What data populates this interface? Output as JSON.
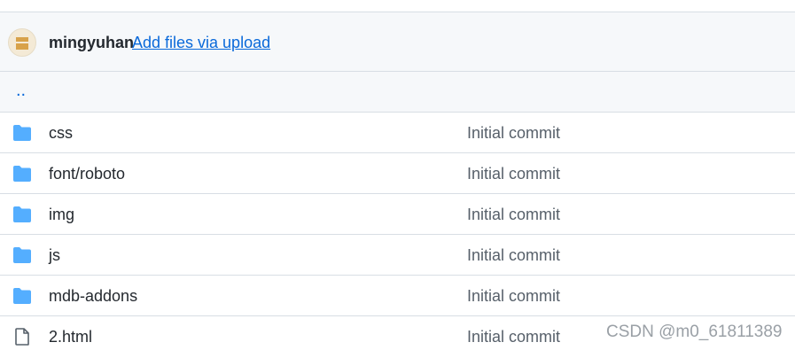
{
  "commit_bar": {
    "author": "mingyuhan",
    "message": "Add files via upload"
  },
  "parent_dir": {
    "label": ".."
  },
  "files": [
    {
      "name": "css",
      "type": "folder",
      "commit_message": "Initial commit"
    },
    {
      "name": "font/roboto",
      "type": "folder",
      "commit_message": "Initial commit"
    },
    {
      "name": "img",
      "type": "folder",
      "commit_message": "Initial commit"
    },
    {
      "name": "js",
      "type": "folder",
      "commit_message": "Initial commit"
    },
    {
      "name": "mdb-addons",
      "type": "folder",
      "commit_message": "Initial commit"
    },
    {
      "name": "2.html",
      "type": "file",
      "commit_message": "Initial commit"
    }
  ],
  "icons": {
    "folder": "folder-icon",
    "file": "file-icon"
  },
  "colors": {
    "folder": "#54aeff",
    "file": "#57606a",
    "link": "#0969da"
  },
  "watermark": "CSDN @m0_61811389"
}
